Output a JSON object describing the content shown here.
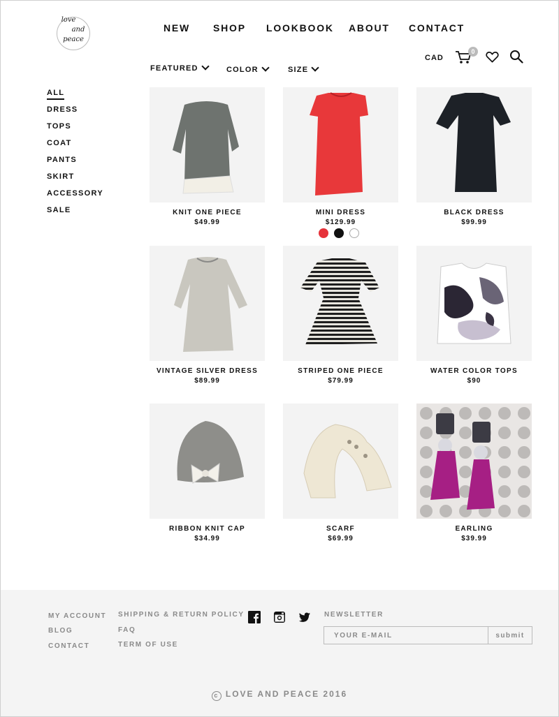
{
  "brand": {
    "logo_text_1": "love",
    "logo_text_2": "and",
    "logo_text_3": "peace"
  },
  "nav": [
    {
      "label": "NEW"
    },
    {
      "label": "SHOP"
    },
    {
      "label": "LOOKBOOK"
    },
    {
      "label": "ABOUT"
    },
    {
      "label": "CONTACT"
    }
  ],
  "utility": {
    "currency": "CAD",
    "cart_count": "0",
    "icons": [
      "cart-icon",
      "heart-icon",
      "search-icon"
    ]
  },
  "filters": [
    {
      "label": "FEATURED"
    },
    {
      "label": "COLOR"
    },
    {
      "label": "SIZE"
    }
  ],
  "categories": [
    {
      "label": "ALL",
      "active": true
    },
    {
      "label": "DRESS"
    },
    {
      "label": "TOPS"
    },
    {
      "label": "COAT"
    },
    {
      "label": "PANTS"
    },
    {
      "label": "SKIRT"
    },
    {
      "label": "ACCESSORY"
    },
    {
      "label": "SALE"
    }
  ],
  "products": [
    {
      "name": "KNIT ONE PIECE",
      "price": "$49.99"
    },
    {
      "name": "MINI DRESS",
      "price": "$129.99"
    },
    {
      "name": "BLACK DRESS",
      "price": "$99.99"
    },
    {
      "name": "VINTAGE SILVER DRESS",
      "price": "$89.99"
    },
    {
      "name": "STRIPED ONE PIECE",
      "price": "$79.99"
    },
    {
      "name": "WATER COLOR TOPS",
      "price": "$90"
    },
    {
      "name": "RIBBON KNIT CAP",
      "price": "$34.99"
    },
    {
      "name": "SCARF",
      "price": "$69.99"
    },
    {
      "name": "EARLING",
      "price": "$39.99"
    }
  ],
  "swatch_colors": [
    "#e6323a",
    "#111111",
    "#ffffff"
  ],
  "footer": {
    "col1": [
      "MY ACCOUNT",
      "BLOG",
      "CONTACT"
    ],
    "col2": [
      "SHIPPING & RETURN POLICY",
      "FAQ",
      "TERM OF USE"
    ],
    "social": [
      "facebook-icon",
      "instagram-icon",
      "twitter-icon"
    ],
    "newsletter_label": "NEWSLETTER",
    "email_placeholder": "YOUR E-MAIL",
    "submit_label": "submit",
    "copyright": "LOVE AND PEACE 2016"
  }
}
